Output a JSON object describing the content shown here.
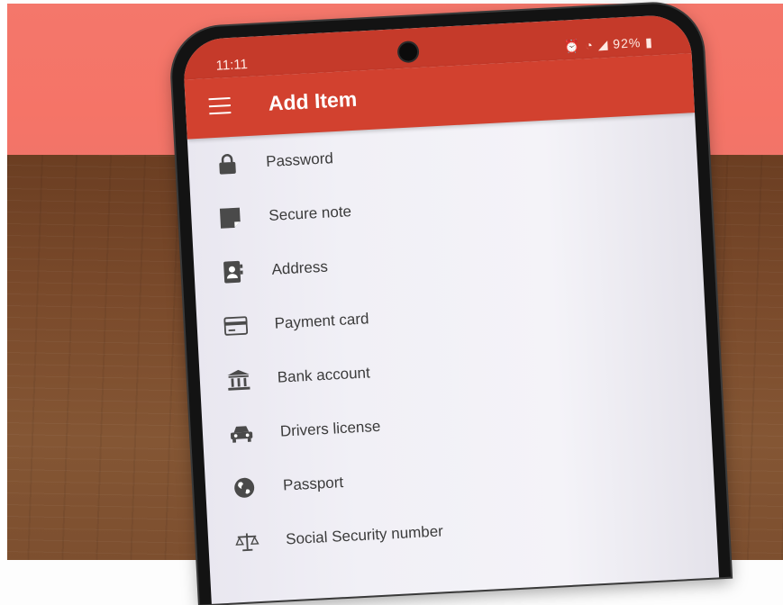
{
  "status_bar": {
    "time": "11:11",
    "battery": "92%"
  },
  "app_bar": {
    "title": "Add Item"
  },
  "items": [
    {
      "label": "Password",
      "icon": "lock-icon"
    },
    {
      "label": "Secure note",
      "icon": "note-icon"
    },
    {
      "label": "Address",
      "icon": "contact-book-icon"
    },
    {
      "label": "Payment card",
      "icon": "credit-card-icon"
    },
    {
      "label": "Bank account",
      "icon": "bank-icon"
    },
    {
      "label": "Drivers license",
      "icon": "car-icon"
    },
    {
      "label": "Passport",
      "icon": "globe-icon"
    },
    {
      "label": "Social Security number",
      "icon": "scales-icon"
    }
  ],
  "colors": {
    "app_bar": "#d2412f",
    "status_bar": "#c53a2a",
    "wall": "#f4776b"
  }
}
